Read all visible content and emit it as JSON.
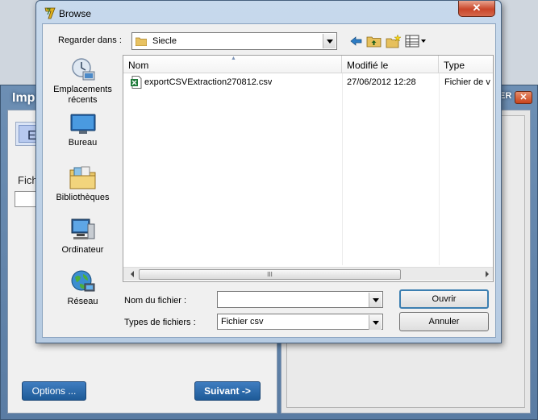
{
  "background_window": {
    "title": "Imp",
    "title_button_label": "ER",
    "close_label": "✕",
    "tab_label": "E",
    "field_label": "Fichi",
    "options_button": "Options ...",
    "next_button": "Suivant ->"
  },
  "dialog": {
    "title": "Browse",
    "close_label": "✕",
    "look_in": {
      "label": "Regarder dans :",
      "value": "Siecle"
    },
    "places": [
      {
        "label": "Emplacements récents",
        "icon": "recent-places-icon"
      },
      {
        "label": "Bureau",
        "icon": "desktop-icon"
      },
      {
        "label": "Bibliothèques",
        "icon": "libraries-icon"
      },
      {
        "label": "Ordinateur",
        "icon": "computer-icon"
      },
      {
        "label": "Réseau",
        "icon": "network-icon"
      }
    ],
    "columns": [
      "Nom",
      "Modifié le",
      "Type"
    ],
    "files": [
      {
        "name": "exportCSVExtraction270812.csv",
        "modified": "27/06/2012 12:28",
        "type": "Fichier de v",
        "icon": "csv-file-icon"
      }
    ],
    "scroll_thumb_grip": "III",
    "file_name": {
      "label": "Nom du fichier :",
      "value": ""
    },
    "file_type": {
      "label": "Types de fichiers :",
      "value": "Fichier csv"
    },
    "open_button": "Ouvrir",
    "cancel_button": "Annuler"
  },
  "colors": {
    "accent_button": "#1e5b98",
    "dialog_frame": "#b6cbe2",
    "close_button": "#c9462a"
  }
}
